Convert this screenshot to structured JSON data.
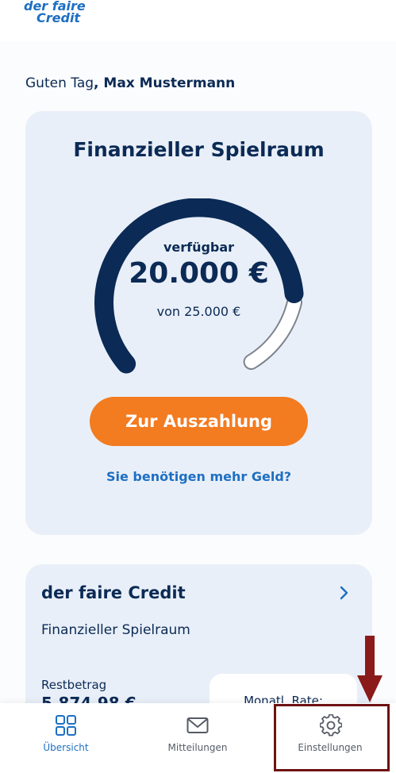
{
  "app": {
    "logo_line1": "der faire",
    "logo_line2": "Credit",
    "brand_color": "#1d6fc3",
    "accent_color": "#f37b20",
    "navy_color": "#0b2a55"
  },
  "greeting": {
    "prefix": "Guten Tag",
    "name": ", Max Mustermann"
  },
  "spielraum_card": {
    "title": "Finanzieller Spielraum",
    "available_label": "verfügbar",
    "available_amount": "20.000 €",
    "total_text": "von 25.000 €",
    "fraction_available": 0.8,
    "payout_button": "Zur Auszahlung",
    "more_money_link": "Sie benötigen mehr Geld?"
  },
  "credit_card": {
    "title": "der faire Credit",
    "subtitle": "Finanzieller Spielraum",
    "rest_label": "Restbetrag",
    "rest_value": "5.874,98 €",
    "rate_label": "Monatl. Rate:"
  },
  "bottom_nav": {
    "items": [
      {
        "label": "Übersicht",
        "icon": "grid-icon",
        "active": true
      },
      {
        "label": "Mitteilungen",
        "icon": "mail-icon",
        "active": false
      },
      {
        "label": "Einstellungen",
        "icon": "gear-icon",
        "active": false
      }
    ]
  },
  "annotation": {
    "highlight_color": "#6e1212",
    "arrow_icon": "down-arrow-icon"
  }
}
